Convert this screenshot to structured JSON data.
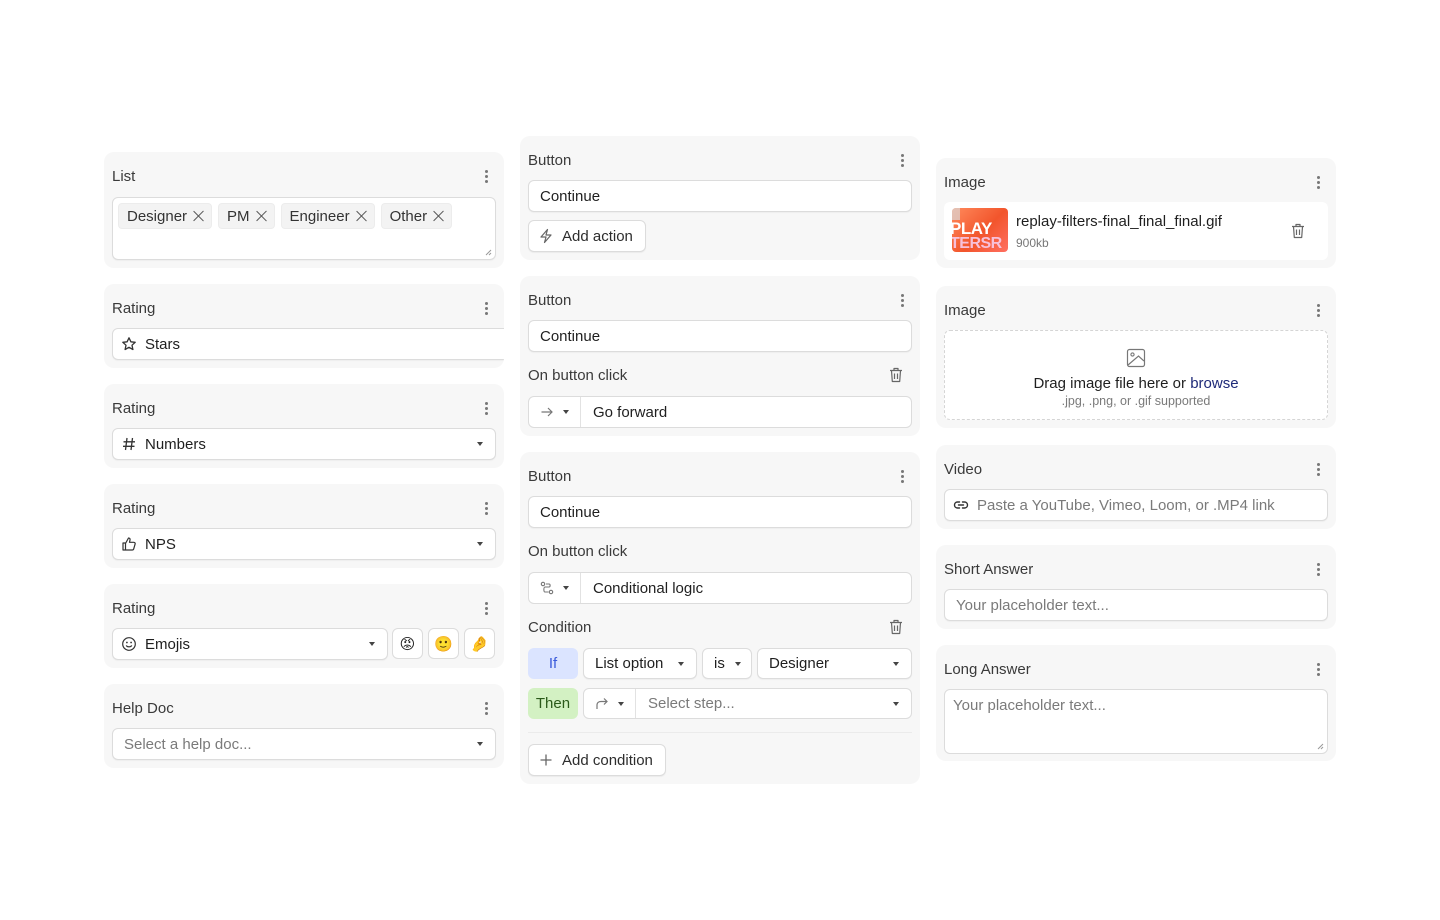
{
  "columns": {
    "left": {
      "list_card": {
        "title": "List",
        "chips": [
          "Designer",
          "PM",
          "Engineer",
          "Other"
        ]
      },
      "rating_stars": {
        "title": "Rating",
        "value": "Stars",
        "icon": "star-icon"
      },
      "rating_numbers": {
        "title": "Rating",
        "value": "Numbers",
        "icon": "hash-icon"
      },
      "rating_nps": {
        "title": "Rating",
        "value": "NPS",
        "icon": "thumbs-up-icon"
      },
      "rating_emojis": {
        "title": "Rating",
        "value": "Emojis",
        "icon": "smiley-icon",
        "emojis": [
          "😡",
          "🙂",
          "🤌"
        ]
      },
      "help_doc": {
        "title": "Help Doc",
        "placeholder": "Select a help doc..."
      }
    },
    "middle": {
      "button_1": {
        "title": "Button",
        "label_value": "Continue",
        "add_action_label": "Add action"
      },
      "button_2": {
        "title": "Button",
        "label_value": "Continue",
        "on_click_label": "On button click",
        "action_value": "Go forward",
        "action_icon": "arrow-right-icon"
      },
      "button_3": {
        "title": "Button",
        "label_value": "Continue",
        "on_click_label": "On button click",
        "action_value": "Conditional logic",
        "action_icon": "route-icon",
        "condition_label": "Condition",
        "if_label": "If",
        "if_field": "List option",
        "operator": "is",
        "if_value": "Designer",
        "then_label": "Then",
        "then_icon": "redirect-arrow-icon",
        "step_placeholder": "Select step...",
        "add_condition_label": "Add condition"
      }
    },
    "right": {
      "image_uploaded": {
        "title": "Image",
        "file_name": "replay-filters-final_final_final.gif",
        "file_size": "900kb",
        "thumb_text_1": "PLAY",
        "thumb_text_2": "TERSR"
      },
      "image_empty": {
        "title": "Image",
        "drop_text": "Drag image file here or ",
        "browse_label": "browse",
        "supported_text": ".jpg, .png, or .gif supported"
      },
      "video": {
        "title": "Video",
        "placeholder": "Paste a YouTube, Vimeo, Loom, or .MP4 link"
      },
      "short_answer": {
        "title": "Short Answer",
        "placeholder": "Your placeholder text..."
      },
      "long_answer": {
        "title": "Long Answer",
        "placeholder": "Your placeholder text..."
      }
    }
  },
  "colors": {
    "card_bg": "#f7f7f7",
    "if_badge_bg": "#dbe4ff",
    "if_badge_text": "#3b5bdb",
    "then_badge_bg": "#d3f1c3",
    "then_badge_text": "#2b5a1a",
    "browse_link": "#1e2a78"
  }
}
